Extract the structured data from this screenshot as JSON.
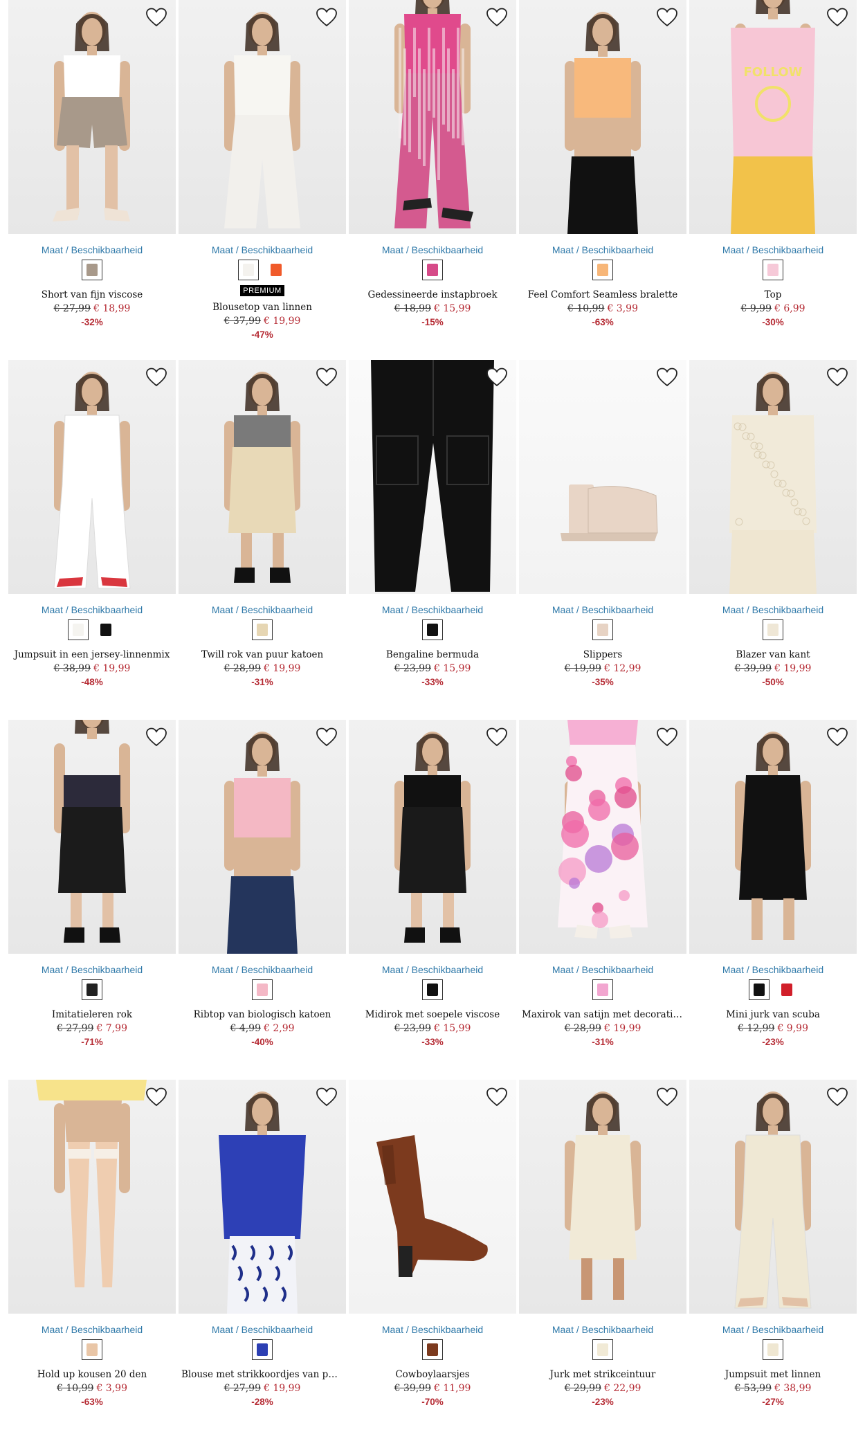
{
  "size_link_label": "Maat / Beschikbaarheid",
  "products": [
    {
      "title": "Short van fijn viscose",
      "old_price": "€ 27,99",
      "new_price": "€ 18,99",
      "discount": "-32%",
      "badge": "",
      "swatches": [
        "#a8998a"
      ],
      "figure": {
        "bg": "#ececec",
        "top": "#ffffff",
        "bottom": "#a8998a",
        "legs": "#e2c1a6",
        "shoes": "#efe3d6",
        "type": "shorts"
      }
    },
    {
      "title": "Blousetop van linnen",
      "old_price": "€ 37,99",
      "new_price": "€ 19,99",
      "discount": "-47%",
      "badge": "PREMIUM",
      "swatches": [
        "#f4f2ee",
        "#f05a2a"
      ],
      "figure": {
        "bg": "#e9e9e9",
        "top": "#f7f6f2",
        "bottom": "#f2f0ec",
        "legs": "#f2f0ec",
        "shoes": "#f2f0ec",
        "type": "pants"
      }
    },
    {
      "title": "Gedessineerde instapbroek",
      "old_price": "€ 18,99",
      "new_price": "€ 15,99",
      "discount": "-15%",
      "badge": "",
      "swatches": [
        "#d64a88"
      ],
      "figure": {
        "bg": "#ececec",
        "top": "#e04a8c",
        "bottom": "#d45a8f",
        "legs": "#e2c1a6",
        "shoes": "#222222",
        "type": "pants-low"
      }
    },
    {
      "title": "Feel Comfort Seamless bralette",
      "old_price": "€ 10,99",
      "new_price": "€ 3,99",
      "discount": "-63%",
      "badge": "",
      "swatches": [
        "#f7b678"
      ],
      "figure": {
        "bg": "#f3f3f3",
        "top": "#f8b97c",
        "bottom": "#111111",
        "legs": "#d8ad8d",
        "shoes": "#111111",
        "type": "crop"
      }
    },
    {
      "title": "Top",
      "old_price": "€ 9,99",
      "new_price": "€ 6,99",
      "discount": "-30%",
      "badge": "",
      "swatches": [
        "#f6c9d8"
      ],
      "figure": {
        "bg": "#ececec",
        "top": "#f7c6d5",
        "bottom": "#f2c24a",
        "legs": "#e0b99b",
        "shoes": "#111111",
        "type": "tee"
      }
    },
    {
      "title": "Jumpsuit in een jersey-linnenmix",
      "old_price": "€ 38,99",
      "new_price": "€ 19,99",
      "discount": "-48%",
      "badge": "",
      "swatches": [
        "#f5f4f0",
        "#111111"
      ],
      "figure": {
        "bg": "#ececec",
        "top": "#ffffff",
        "bottom": "#ffffff",
        "legs": "#ffffff",
        "shoes": "#d9363e",
        "type": "jumpsuit"
      }
    },
    {
      "title": "Twill rok van puur katoen",
      "old_price": "€ 28,99",
      "new_price": "€ 19,99",
      "discount": "-31%",
      "badge": "",
      "swatches": [
        "#e6d6b3"
      ],
      "figure": {
        "bg": "#ececec",
        "top": "#7a7a7a",
        "bottom": "#e8d9b7",
        "legs": "#d9b596",
        "shoes": "#111111",
        "type": "midi"
      }
    },
    {
      "title": "Bengaline bermuda",
      "old_price": "€ 23,99",
      "new_price": "€ 15,99",
      "discount": "-33%",
      "badge": "",
      "swatches": [
        "#111111"
      ],
      "figure": {
        "bg": "#ffffff",
        "top": "#111111",
        "bottom": "#111111",
        "legs": "#111111",
        "shoes": "#111111",
        "type": "flatpants"
      }
    },
    {
      "title": "Slippers",
      "old_price": "€ 19,99",
      "new_price": "€ 12,99",
      "discount": "-35%",
      "badge": "",
      "swatches": [
        "#e7d3c4"
      ],
      "figure": {
        "bg": "#f6f6f6",
        "top": "#e8d5c6",
        "bottom": "#e8d5c6",
        "legs": "#e8d5c6",
        "shoes": "#e8d5c6",
        "type": "mule"
      }
    },
    {
      "title": "Blazer van kant",
      "old_price": "€ 39,99",
      "new_price": "€ 19,99",
      "discount": "-50%",
      "badge": "",
      "swatches": [
        "#efe7d6"
      ],
      "figure": {
        "bg": "#ececec",
        "top": "#f1ead9",
        "bottom": "#f1ead9",
        "legs": "#e2c1a6",
        "shoes": "#f1ead9",
        "type": "blazer"
      }
    },
    {
      "title": "Imitatieleren rok",
      "old_price": "€ 27,99",
      "new_price": "€ 7,99",
      "discount": "-71%",
      "badge": "",
      "swatches": [
        "#222222"
      ],
      "figure": {
        "bg": "#ececec",
        "top": "#2c2a3a",
        "bottom": "#1b1b1b",
        "legs": "#e2c1a6",
        "shoes": "#111111",
        "type": "midi"
      }
    },
    {
      "title": "Ribtop van biologisch katoen",
      "old_price": "€ 4,99",
      "new_price": "€ 2,99",
      "discount": "-40%",
      "badge": "",
      "swatches": [
        "#f4b8c6"
      ],
      "figure": {
        "bg": "#e9e9e9",
        "top": "#f4b8c4",
        "bottom": "#24355c",
        "legs": "#d7ae8e",
        "shoes": "#24355c",
        "type": "crop"
      }
    },
    {
      "title": "Midirok met soepele viscose",
      "old_price": "€ 23,99",
      "new_price": "€ 15,99",
      "discount": "-33%",
      "badge": "",
      "swatches": [
        "#111111"
      ],
      "figure": {
        "bg": "#ececec",
        "top": "#111111",
        "bottom": "#1a1a1a",
        "legs": "#e2c1a6",
        "shoes": "#111111",
        "type": "midi"
      }
    },
    {
      "title": "Maxirok van satijn met decoratieve …",
      "old_price": "€ 28,99",
      "new_price": "€ 19,99",
      "discount": "-31%",
      "badge": "",
      "swatches": [
        "#f2a6d0"
      ],
      "figure": {
        "bg": "#ececec",
        "top": "#f6b0d4",
        "bottom": "#f0a3cc",
        "legs": "#e2c1a6",
        "shoes": "#f4efe8",
        "type": "maxi"
      }
    },
    {
      "title": "Mini jurk van scuba",
      "old_price": "€ 12,99",
      "new_price": "€ 9,99",
      "discount": "-23%",
      "badge": "",
      "swatches": [
        "#111111",
        "#d11f2a"
      ],
      "figure": {
        "bg": "#ececec",
        "top": "#111111",
        "bottom": "#111111",
        "legs": "#d9b596",
        "shoes": "#222222",
        "type": "dress"
      }
    },
    {
      "title": "Hold up kousen 20 den",
      "old_price": "€ 10,99",
      "new_price": "€ 3,99",
      "discount": "-63%",
      "badge": "",
      "swatches": [
        "#e9c6a7"
      ],
      "figure": {
        "bg": "#ececec",
        "top": "#f7e38b",
        "bottom": "#f2d9c4",
        "legs": "#efcdb0",
        "shoes": "#efcdb0",
        "type": "legs"
      }
    },
    {
      "title": "Blouse met strikkoordjes van puur …",
      "old_price": "€ 27,99",
      "new_price": "€ 19,99",
      "discount": "-28%",
      "badge": "",
      "swatches": [
        "#2c3fb3"
      ],
      "figure": {
        "bg": "#e9e9e9",
        "top": "#2d40b6",
        "bottom": "#1f2f8a",
        "legs": "#d7ae8e",
        "shoes": "#111111",
        "type": "blouse"
      }
    },
    {
      "title": "Cowboylaarsjes",
      "old_price": "€ 39,99",
      "new_price": "€ 11,99",
      "discount": "-70%",
      "badge": "",
      "swatches": [
        "#7c3a1e"
      ],
      "figure": {
        "bg": "#f7f7f7",
        "top": "#7c3a1e",
        "bottom": "#7c3a1e",
        "legs": "#7c3a1e",
        "shoes": "#7c3a1e",
        "type": "boot"
      }
    },
    {
      "title": "Jurk met strikceintuur",
      "old_price": "€ 29,99",
      "new_price": "€ 22,99",
      "discount": "-23%",
      "badge": "",
      "swatches": [
        "#f1ead6"
      ],
      "figure": {
        "bg": "#ececec",
        "top": "#f1ead7",
        "bottom": "#f1ead7",
        "legs": "#c89674",
        "shoes": "#f1ead7",
        "type": "dress"
      }
    },
    {
      "title": "Jumpsuit met linnen",
      "old_price": "€ 53,99",
      "new_price": "€ 38,99",
      "discount": "-27%",
      "badge": "",
      "swatches": [
        "#efe7d2"
      ],
      "figure": {
        "bg": "#ececec",
        "top": "#efe8d4",
        "bottom": "#efe8d4",
        "legs": "#efe8d4",
        "shoes": "#e2c1a6",
        "type": "jumpsuit"
      }
    }
  ]
}
